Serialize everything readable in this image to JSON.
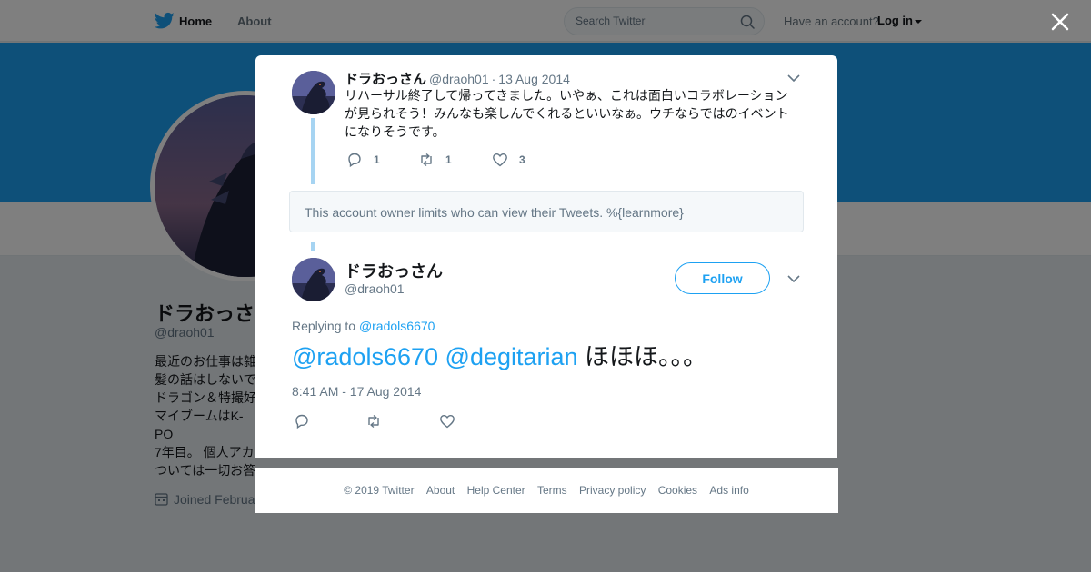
{
  "nav": {
    "home_label": "Home",
    "about_label": "About",
    "search_placeholder": "Search Twitter",
    "have_account": "Have an account?",
    "login_label": "Log in"
  },
  "profile": {
    "name": "ドラおっさ",
    "handle": "@draoh01",
    "bio": "最近のお仕事は雑\n髪の話はしないで\nドラゴン＆特撮好\nマイブームはK-PO\n7年目。 個人アカ\nついては一切お答\n承ください。",
    "joined": "Joined Februa"
  },
  "tweet1": {
    "name": "ドラおっさん",
    "handle": "@draoh01",
    "separator": "·",
    "date": "13 Aug 2014",
    "text": "リハーサル終了して帰ってきました。いやぁ、これは面白いコラボレーションが見られそう！みんなも楽しんでくれるといいなぁ。ウチならではのイベントになりそうです。",
    "replies": "1",
    "retweets": "1",
    "likes": "3"
  },
  "limit_notice": "This account owner limits who can view their Tweets. %{learnmore}",
  "tweet2": {
    "name": "ドラおっさん",
    "handle": "@draoh01",
    "follow_label": "Follow",
    "replying_prefix": "Replying to",
    "replying_to": "@radols6670",
    "mention1": "@radols6670",
    "mention2": "@degitarian",
    "body": "ほほほ。。。",
    "timestamp": "8:41 AM - 17 Aug 2014"
  },
  "footer": {
    "copyright": "© 2019 Twitter",
    "links": [
      "About",
      "Help Center",
      "Terms",
      "Privacy policy",
      "Cookies",
      "Ads info"
    ]
  },
  "colors": {
    "accent": "#1da1f2",
    "thread_line": "#a6d4f2",
    "muted_text": "#657786",
    "overlay": "rgba(0,0,0,0.5)"
  }
}
